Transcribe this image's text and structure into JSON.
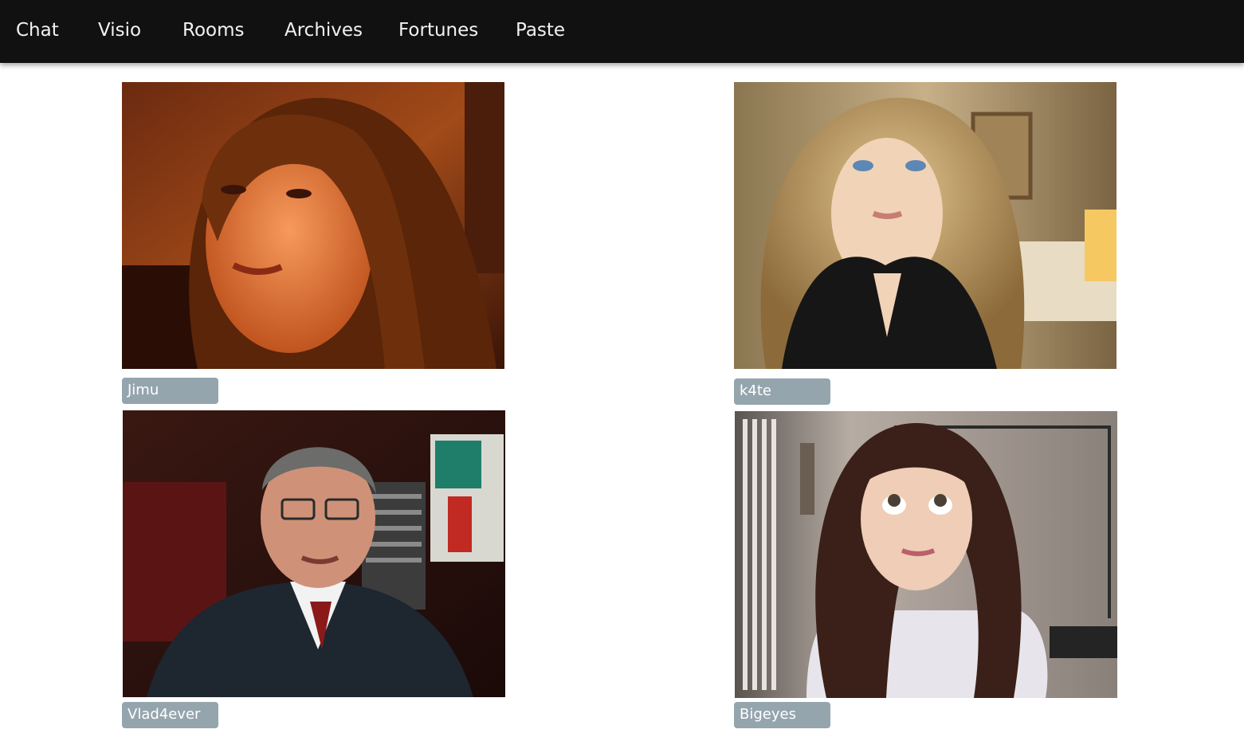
{
  "nav": {
    "items": [
      "Chat",
      "Visio",
      "Rooms",
      "Archives",
      "Fortunes",
      "Paste"
    ]
  },
  "participants": [
    {
      "name": "Jimu"
    },
    {
      "name": "k4te"
    },
    {
      "name": "Vlad4ever"
    },
    {
      "name": "Bigeyes"
    }
  ],
  "colors": {
    "topbar": "#111111",
    "nav_text": "#f2f2f2",
    "label_bg": "#95a5ae",
    "label_text": "#ffffff",
    "page_bg": "#ffffff"
  }
}
